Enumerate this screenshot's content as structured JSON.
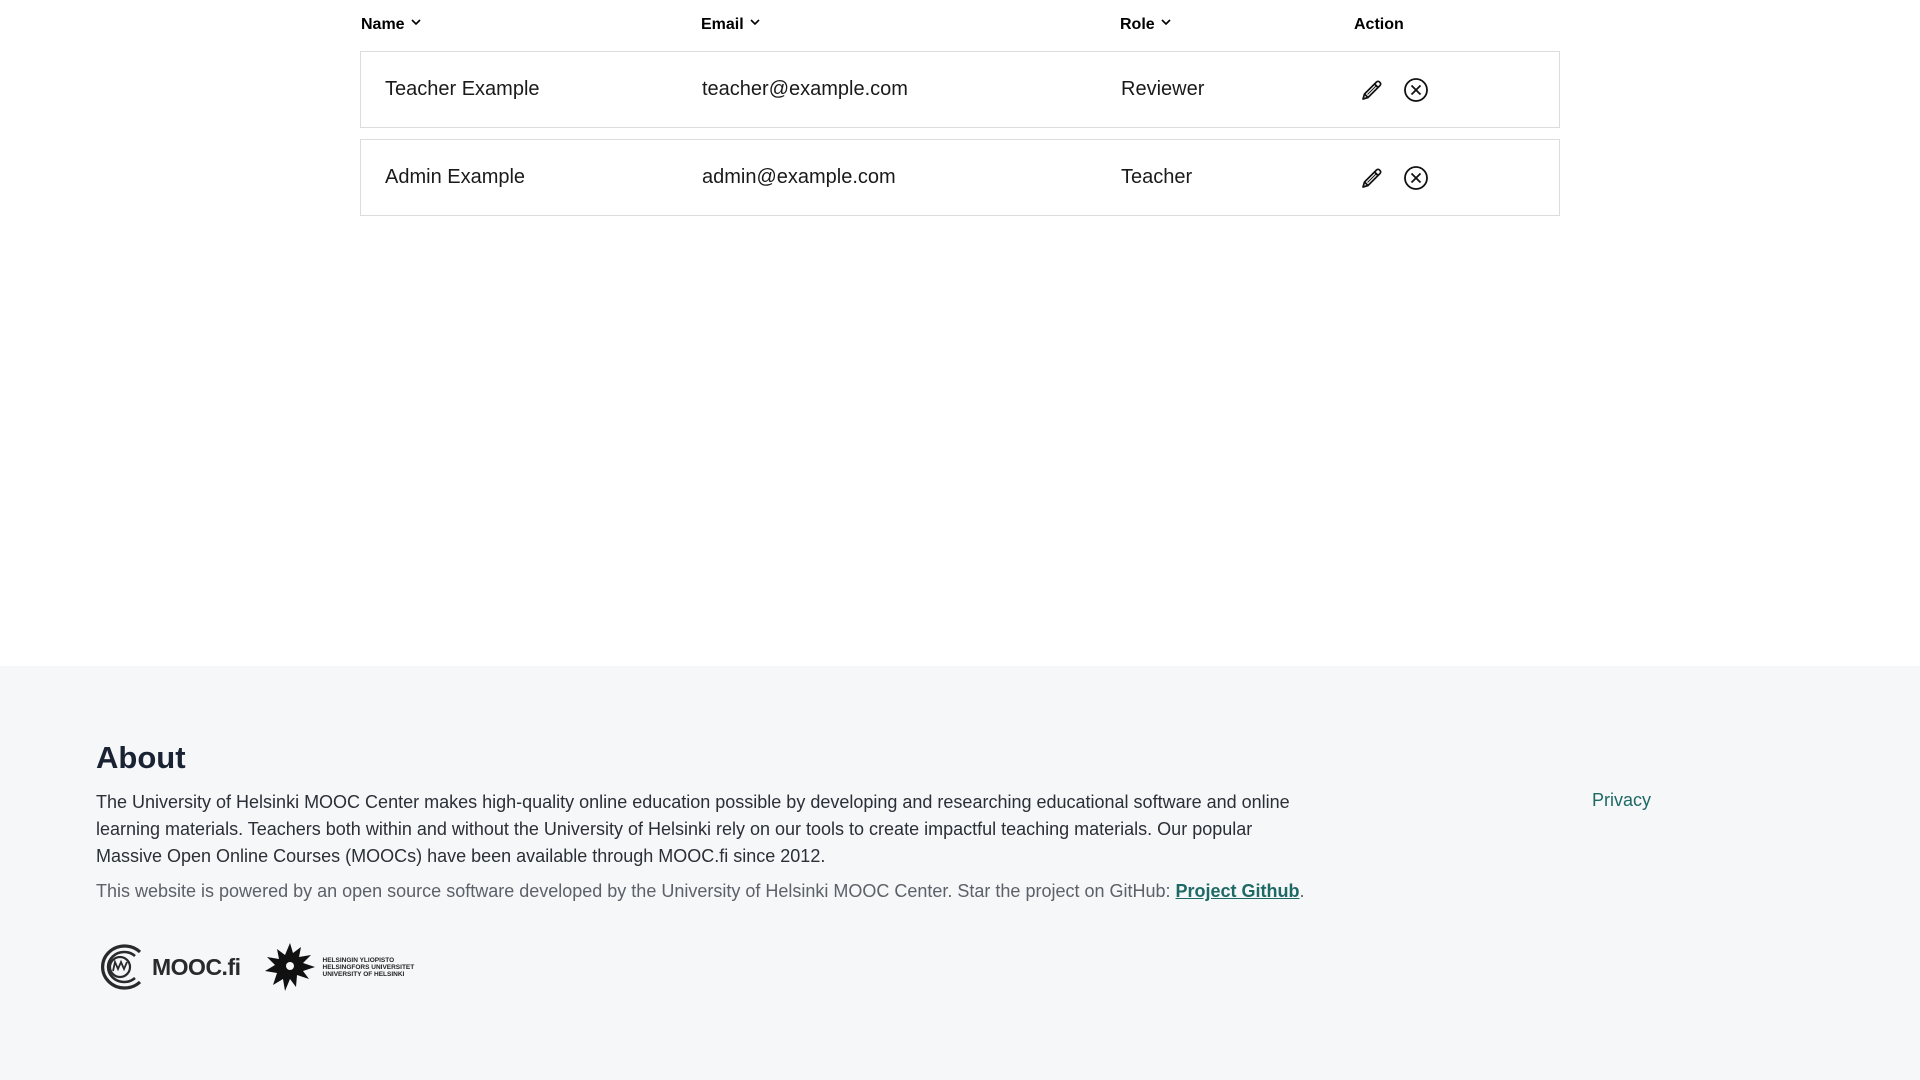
{
  "table": {
    "headers": {
      "name": "Name",
      "email": "Email",
      "role": "Role",
      "action": "Action"
    },
    "rows": [
      {
        "name": "Teacher Example",
        "email": "teacher@example.com",
        "role": "Reviewer"
      },
      {
        "name": "Admin Example",
        "email": "admin@example.com",
        "role": "Teacher"
      }
    ],
    "icons": {
      "sort": "chevron-down-icon",
      "edit": "pencil-icon",
      "remove": "close-circle-icon"
    }
  },
  "footer": {
    "about_title": "About",
    "about_text": "The University of Helsinki MOOC Center makes high-quality online education possible by developing and researching educational software and online learning materials. Teachers both within and without the University of Helsinki rely on our tools to create impactful teaching materials. Our popular Massive Open Online Courses (MOOCs) have been available through MOOC.fi since 2012.",
    "powered_text": "This website is powered by an open source software developed by the University of Helsinki MOOC Center. Star the project on GitHub: ",
    "github_link": "Project Github",
    "powered_end": ".",
    "privacy_link": "Privacy",
    "mooc_logo_text": "MOOC.fi",
    "hy_logo_lines": [
      "HELSINGIN YLIOPISTO",
      "HELSINGFORS UNIVERSITET",
      "UNIVERSITY OF HELSINKI"
    ]
  },
  "colors": {
    "footer_bg": "#f5f7f9",
    "link": "#1f6964",
    "row_border": "#dcdcdc"
  }
}
